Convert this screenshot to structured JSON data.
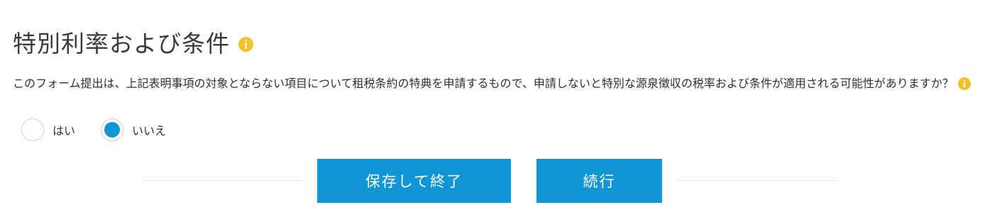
{
  "section": {
    "title": "特別利率および条件",
    "title_info_icon": "info-icon"
  },
  "question": {
    "text": "このフォーム提出は、上記表明事項の対象とならない項目について租税条約の特典を申請するもので、申請しないと特別な源泉徴収の税率および条件が適用される可能性がありますか？",
    "info_icon": "info-icon"
  },
  "options": [
    {
      "label": "はい",
      "selected": false
    },
    {
      "label": "いいえ",
      "selected": true
    }
  ],
  "buttons": {
    "save_and_exit": "保存して終了",
    "continue": "続行"
  },
  "colors": {
    "primary": "#1096d4",
    "info": "#f2c12e"
  }
}
